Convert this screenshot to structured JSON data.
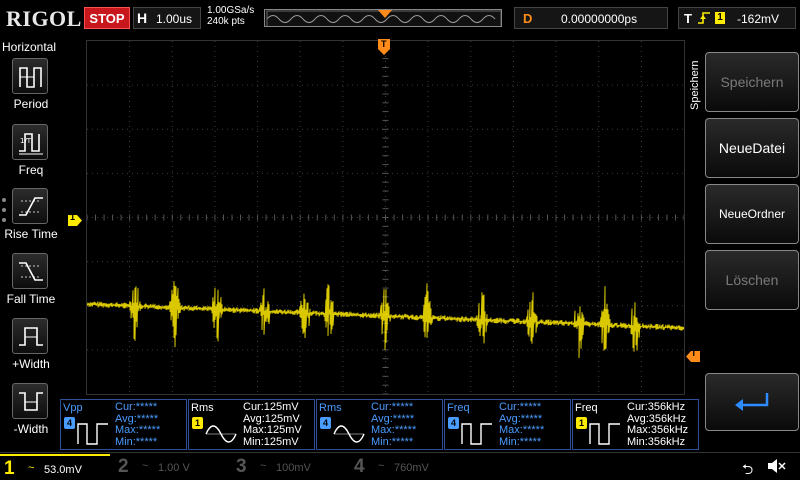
{
  "header": {
    "brand": "RIGOL",
    "run_state": "STOP",
    "run_state_color": "#c8161d",
    "horizontal_label": "H",
    "timebase": "1.00us",
    "sample_rate": "1.00GSa/s",
    "memory_depth": "240k pts",
    "delay_label": "D",
    "delay_value": "0.00000000ps",
    "trigger_label": "T",
    "trigger_level": "-162mV"
  },
  "left_panel": {
    "title": "Horizontal",
    "items": [
      {
        "label": "Period",
        "icon": "period-icon"
      },
      {
        "label": "Freq",
        "icon": "freq-icon"
      },
      {
        "label": "Rise Time",
        "icon": "rise-time-icon"
      },
      {
        "label": "Fall Time",
        "icon": "fall-time-icon"
      },
      {
        "label": "+Width",
        "icon": "pos-width-icon"
      },
      {
        "label": "-Width",
        "icon": "neg-width-icon"
      }
    ]
  },
  "right_panel": {
    "tab": "Speichern",
    "keys": [
      {
        "label": "Speichern",
        "enabled": false
      },
      {
        "label": "NeueDatei",
        "enabled": true
      },
      {
        "label": "NeueOrdner",
        "enabled": true
      },
      {
        "label": "Löschen",
        "enabled": false
      }
    ]
  },
  "markers": {
    "ch1_offset_label": "1",
    "trigger_pos_label": "T"
  },
  "measurements": [
    {
      "name": "Vpp",
      "channel": "4",
      "color": "#4a9cff",
      "wave": "pulse",
      "cur": "Cur:*****",
      "avg": "Avg:*****",
      "max": "Max:*****",
      "min": "Min:*****"
    },
    {
      "name": "Rms",
      "channel": "1",
      "color": "#ffeb00",
      "wave": "sine",
      "cur": "Cur:125mV",
      "avg": "Avg:125mV",
      "max": "Max:125mV",
      "min": "Min:125mV"
    },
    {
      "name": "Rms",
      "channel": "4",
      "color": "#4a9cff",
      "wave": "sine",
      "cur": "Cur:*****",
      "avg": "Avg:*****",
      "max": "Max:*****",
      "min": "Min:*****"
    },
    {
      "name": "Freq",
      "channel": "4",
      "color": "#4a9cff",
      "wave": "pulse",
      "cur": "Cur:*****",
      "avg": "Avg:*****",
      "max": "Max:*****",
      "min": "Min:*****"
    },
    {
      "name": "Freq",
      "channel": "1",
      "color": "#ffeb00",
      "wave": "pulse",
      "cur": "Cur:356kHz",
      "avg": "Avg:356kHz",
      "max": "Max:356kHz",
      "min": "Min:356kHz"
    }
  ],
  "channels": [
    {
      "num": "1",
      "coupling": "~",
      "scale": "53.0mV",
      "active": true,
      "color": "#ffeb00"
    },
    {
      "num": "2",
      "coupling": "~",
      "scale": "1.00 V",
      "active": false,
      "color": "#00e5ff"
    },
    {
      "num": "3",
      "coupling": "~",
      "scale": "100mV",
      "active": false,
      "color": "#ff44ff"
    },
    {
      "num": "4",
      "coupling": "~",
      "scale": "760mV",
      "active": false,
      "color": "#4a9cff"
    }
  ],
  "status_icons": [
    "usb-icon",
    "speaker-muted-icon"
  ]
}
